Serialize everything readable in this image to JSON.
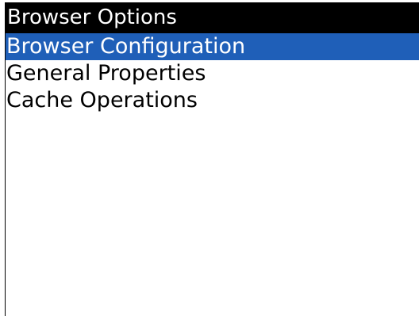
{
  "screen": {
    "title": "Browser Options"
  },
  "menu": {
    "items": [
      {
        "label": "Browser Configuration",
        "selected": true
      },
      {
        "label": "General Properties",
        "selected": false
      },
      {
        "label": "Cache Operations",
        "selected": false
      }
    ]
  },
  "colors": {
    "title_background": "#000000",
    "title_text": "#ffffff",
    "selection_background": "#1f5fb8",
    "selection_text": "#ffffff",
    "background": "#ffffff"
  }
}
